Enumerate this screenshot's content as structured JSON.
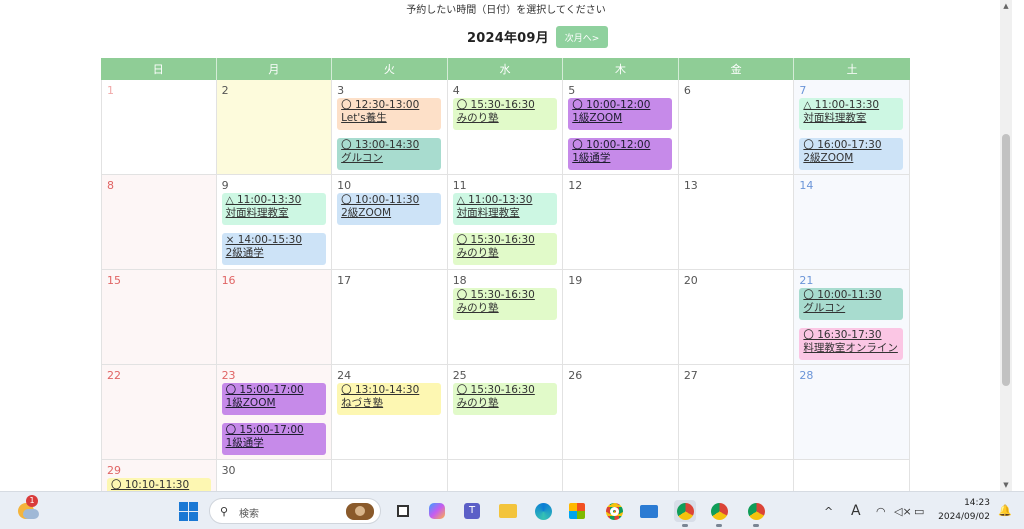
{
  "header": {
    "instruction": "予約したい時間（日付）を選択してください",
    "month_title": "2024年09月",
    "next_button": "次月へ>"
  },
  "weekdays": [
    "日",
    "月",
    "火",
    "水",
    "木",
    "金",
    "土"
  ],
  "weeks": [
    [
      {
        "day": "1",
        "type": "sun-first",
        "events": []
      },
      {
        "day": "2",
        "type": "today",
        "events": []
      },
      {
        "day": "3",
        "type": "",
        "events": [
          {
            "time": "〇 12:30-13:00",
            "name": "Let's養生",
            "color": "orange"
          },
          {
            "time": "〇 13:00-14:30",
            "name": "グルコン",
            "color": "teal"
          }
        ]
      },
      {
        "day": "4",
        "type": "",
        "events": [
          {
            "time": "〇 15:30-16:30",
            "name": "みのり塾",
            "color": "green"
          }
        ]
      },
      {
        "day": "5",
        "type": "",
        "events": [
          {
            "time": "〇 10:00-12:00",
            "name": "1級ZOOM",
            "color": "purple"
          },
          {
            "time": "〇 10:00-12:00",
            "name": "1級通学",
            "color": "purple"
          }
        ]
      },
      {
        "day": "6",
        "type": "",
        "events": []
      },
      {
        "day": "7",
        "type": "sat",
        "events": [
          {
            "time": "△ 11:00-13:30",
            "name": "対面料理教室",
            "color": "mint"
          },
          {
            "time": "〇 16:00-17:30",
            "name": "2級ZOOM",
            "color": "blue"
          }
        ]
      }
    ],
    [
      {
        "day": "8",
        "type": "sun",
        "events": []
      },
      {
        "day": "9",
        "type": "",
        "events": [
          {
            "time": "△ 11:00-13:30",
            "name": "対面料理教室",
            "color": "mint"
          },
          {
            "time": "× 14:00-15:30",
            "name": "2級通学",
            "color": "blue"
          }
        ]
      },
      {
        "day": "10",
        "type": "",
        "events": [
          {
            "time": "〇 10:00-11:30",
            "name": "2級ZOOM",
            "color": "blue"
          }
        ]
      },
      {
        "day": "11",
        "type": "",
        "events": [
          {
            "time": "△ 11:00-13:30",
            "name": "対面料理教室",
            "color": "mint"
          },
          {
            "time": "〇 15:30-16:30",
            "name": "みのり塾",
            "color": "green"
          }
        ]
      },
      {
        "day": "12",
        "type": "",
        "events": []
      },
      {
        "day": "13",
        "type": "",
        "events": []
      },
      {
        "day": "14",
        "type": "sat",
        "events": []
      }
    ],
    [
      {
        "day": "15",
        "type": "sun",
        "events": []
      },
      {
        "day": "16",
        "type": "holiday",
        "events": []
      },
      {
        "day": "17",
        "type": "",
        "events": []
      },
      {
        "day": "18",
        "type": "",
        "events": [
          {
            "time": "〇 15:30-16:30",
            "name": "みのり塾",
            "color": "green"
          }
        ]
      },
      {
        "day": "19",
        "type": "",
        "events": []
      },
      {
        "day": "20",
        "type": "",
        "events": []
      },
      {
        "day": "21",
        "type": "sat",
        "events": [
          {
            "time": "〇 10:00-11:30",
            "name": "グルコン",
            "color": "teal"
          },
          {
            "time": "〇 16:30-17:30",
            "name": "料理教室オンライン",
            "color": "pink"
          }
        ]
      }
    ],
    [
      {
        "day": "22",
        "type": "sun",
        "events": []
      },
      {
        "day": "23",
        "type": "holiday",
        "events": [
          {
            "time": "〇 15:00-17:00",
            "name": "1級ZOOM",
            "color": "purple"
          },
          {
            "time": "〇 15:00-17:00",
            "name": "1級通学",
            "color": "purple"
          }
        ]
      },
      {
        "day": "24",
        "type": "",
        "events": [
          {
            "time": "〇 13:10-14:30",
            "name": "ねづき塾",
            "color": "yellow"
          }
        ]
      },
      {
        "day": "25",
        "type": "",
        "events": [
          {
            "time": "〇 15:30-16:30",
            "name": "みのり塾",
            "color": "green"
          }
        ]
      },
      {
        "day": "26",
        "type": "",
        "events": []
      },
      {
        "day": "27",
        "type": "",
        "events": []
      },
      {
        "day": "28",
        "type": "sat",
        "events": []
      }
    ],
    [
      {
        "day": "29",
        "type": "sun",
        "events": [
          {
            "time": "〇 10:10-11:30",
            "name": "",
            "color": "yellow"
          }
        ]
      },
      {
        "day": "30",
        "type": "",
        "events": []
      },
      {
        "day": "",
        "type": "",
        "events": []
      },
      {
        "day": "",
        "type": "",
        "events": []
      },
      {
        "day": "",
        "type": "",
        "events": []
      },
      {
        "day": "",
        "type": "",
        "events": []
      },
      {
        "day": "",
        "type": "",
        "events": []
      }
    ]
  ],
  "taskbar": {
    "weather_badge": "1",
    "search_placeholder": "検索",
    "time": "14:23",
    "date": "2024/09/02",
    "ime": "A"
  },
  "colors": {
    "header_green": "#8fcd96",
    "button_green": "#8fd19e",
    "today_yellow": "#fdfbdc"
  }
}
